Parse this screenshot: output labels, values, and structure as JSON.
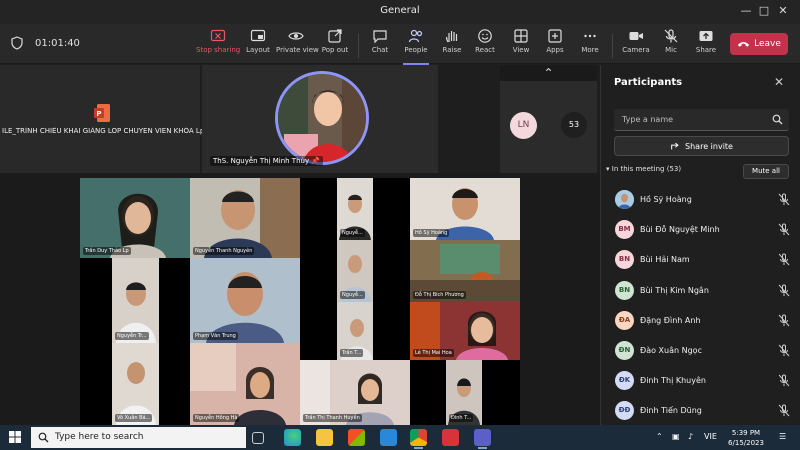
{
  "window": {
    "title": "General"
  },
  "meeting": {
    "timer": "01:01:40"
  },
  "toolbar": {
    "buttons": [
      {
        "label": "Stop sharing",
        "icon": "stop-share-icon"
      },
      {
        "label": "Layout",
        "icon": "layout-icon"
      },
      {
        "label": "Private view",
        "icon": "eye-icon"
      },
      {
        "label": "Pop out",
        "icon": "pop-out-icon"
      },
      {
        "label": "Chat",
        "icon": "chat-icon"
      },
      {
        "label": "People",
        "icon": "people-icon"
      },
      {
        "label": "Raise",
        "icon": "hand-icon"
      },
      {
        "label": "React",
        "icon": "smile-icon"
      },
      {
        "label": "View",
        "icon": "grid-icon"
      },
      {
        "label": "Apps",
        "icon": "apps-icon"
      },
      {
        "label": "More",
        "icon": "more-icon"
      },
      {
        "label": "Camera",
        "icon": "camera-icon"
      },
      {
        "label": "Mic",
        "icon": "mic-off-icon"
      },
      {
        "label": "Share",
        "icon": "share-icon"
      }
    ],
    "leave_label": "Leave"
  },
  "stage": {
    "shared_content_title": "ILE_TRÌNH CHIẾU KHAI GIẢNG LOP CHUYEN VIEN KHÓA Lpp",
    "active_speaker": "ThS. Nguyễn Thị Minh Thùy",
    "mini_avatar": "LN",
    "more_count": "53"
  },
  "grid": {
    "tiles": [
      {
        "name": "Trần Duy Thảo Lp"
      },
      {
        "name": "Nguyễn Thanh Nguyên"
      },
      {
        "name": "Nguyễ..."
      },
      {
        "name": "Hồ Sỹ Hoàng"
      },
      {
        "name": "Nguyễn Tr..."
      },
      {
        "name": "Phạm Văn Trung"
      },
      {
        "name": "Nguyễ..."
      },
      {
        "name": "Đỗ Thị Bích Phương"
      },
      {
        "name": "Trần T..."
      },
      {
        "name": "Lê Thị Mai Hoa"
      },
      {
        "name": "Võ Xuân Bá..."
      },
      {
        "name": "Nguyễn Hồng Hà"
      },
      {
        "name": "Trần Thị Thanh Huyền"
      },
      {
        "name": "Đinh T..."
      }
    ]
  },
  "panel": {
    "title": "Participants",
    "search_placeholder": "Type a name",
    "invite_label": "Share invite",
    "section_label": "In this meeting (53)",
    "mute_all_label": "Mute all",
    "participants": [
      {
        "initials": "",
        "name": "Hồ Sỹ Hoàng",
        "color": "#9cc3e0",
        "fg": "#1c3a55",
        "photo": true
      },
      {
        "initials": "BM",
        "name": "Bùi Đỗ Nguyệt Minh",
        "color": "#f6d5db",
        "fg": "#8a2e45"
      },
      {
        "initials": "BN",
        "name": "Bùi Hải Nam",
        "color": "#f6d5db",
        "fg": "#8a2e45"
      },
      {
        "initials": "BN",
        "name": "Bùi Thị Kim Ngân",
        "color": "#cfe5d2",
        "fg": "#2e5a37"
      },
      {
        "initials": "ĐA",
        "name": "Đặng Đình Anh",
        "color": "#fbd6c2",
        "fg": "#8a3d16"
      },
      {
        "initials": "ĐN",
        "name": "Đào Xuân Ngọc",
        "color": "#cfe5d2",
        "fg": "#2e5a37"
      },
      {
        "initials": "ĐK",
        "name": "Đinh Thị Khuyên",
        "color": "#d4dcf5",
        "fg": "#2f3f7a"
      },
      {
        "initials": "ĐĐ",
        "name": "Đinh Tiến Dũng",
        "color": "#d4dcf5",
        "fg": "#2f3f7a"
      }
    ]
  },
  "taskbar": {
    "search_placeholder": "Type here to search",
    "language": "VIE",
    "time": "5:39 PM",
    "date": "6/15/2023"
  }
}
